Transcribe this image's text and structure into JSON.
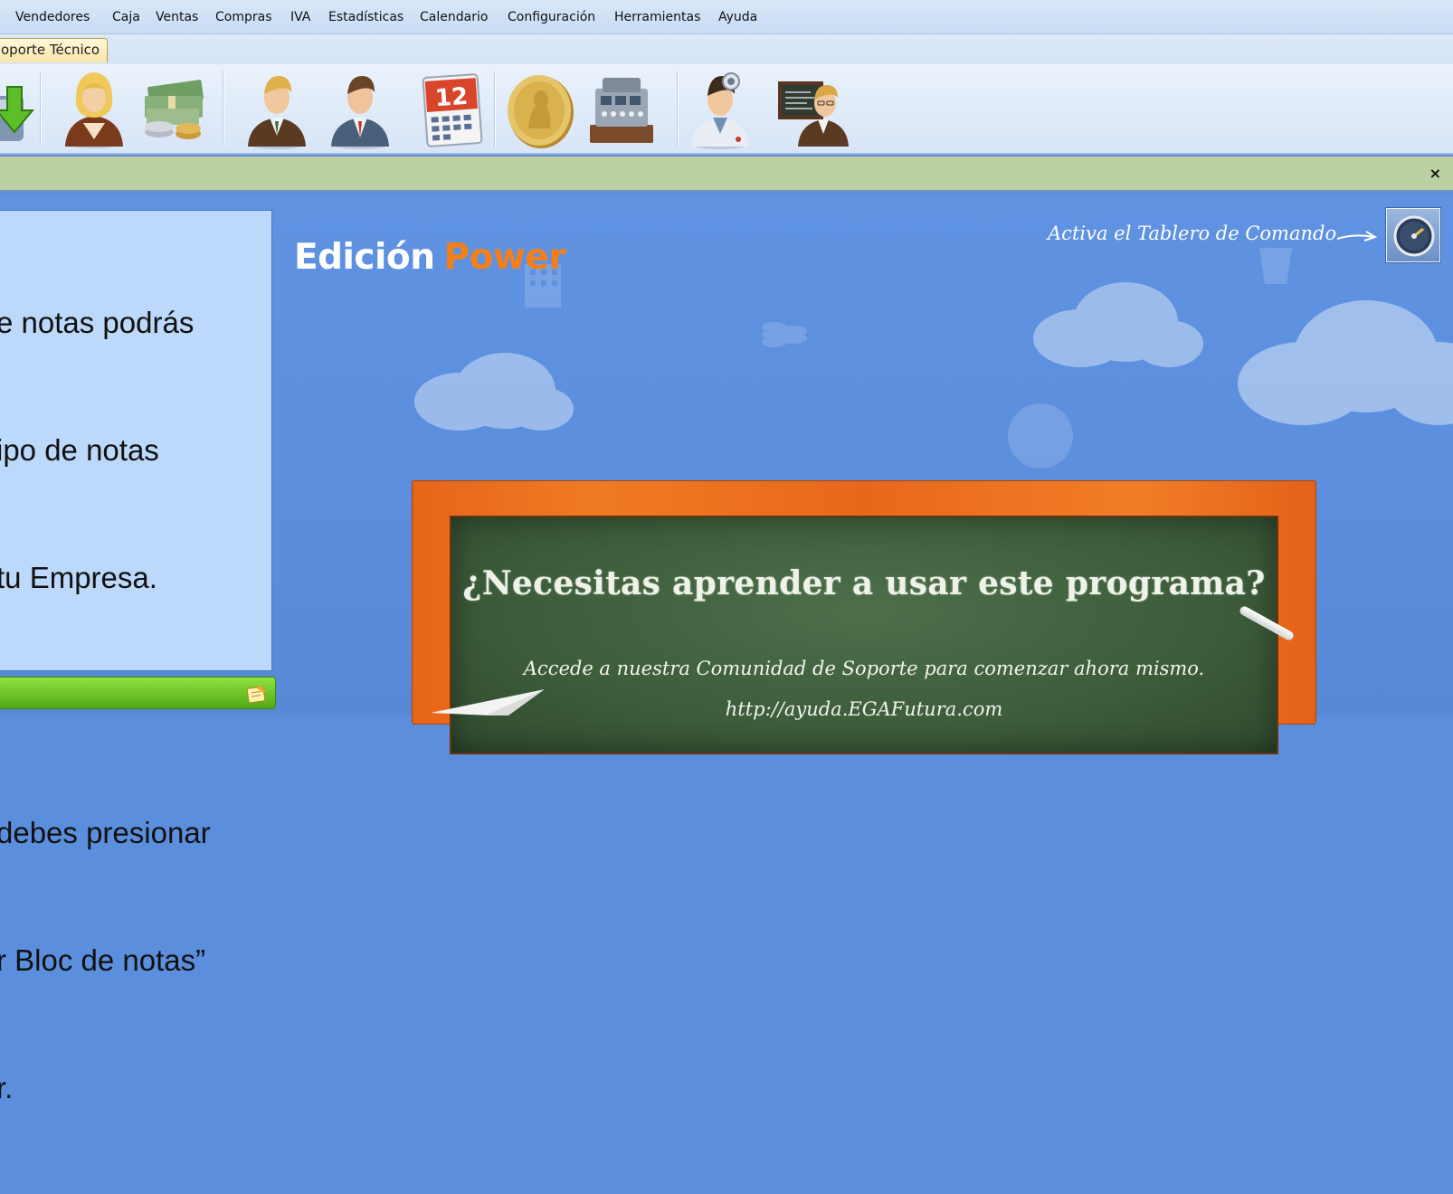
{
  "menubar": {
    "items": [
      "Vendedores",
      "Caja",
      "Ventas",
      "Compras",
      "IVA",
      "Estadísticas",
      "Calendario",
      "Configuración",
      "Herramientas",
      "Ayuda"
    ]
  },
  "tabs": {
    "active": "oporte Técnico"
  },
  "toolbar": {
    "buttons": [
      "download-icon",
      "female-user-icon",
      "money-icon",
      "businessman-icon",
      "seller-icon",
      "calendar-icon",
      "coin-icon",
      "cash-register-icon",
      "doctor-icon",
      "teacher-icon"
    ],
    "calendar_day": "12"
  },
  "notification": {
    "close_label": "×"
  },
  "side_panel": {
    "lines": [
      "e notas podrás",
      "ipo de notas",
      "tu Empresa.",
      "",
      "debes presionar",
      "r Bloc de notas”",
      "r."
    ]
  },
  "brand": {
    "part1": "Edición",
    "part2": "Power"
  },
  "dashboard": {
    "label": "Activa el Tablero de Comando"
  },
  "board": {
    "title": "¿Necesitas aprender a usar este programa?",
    "subtitle": "Accede a nuestra Comunidad de Soporte para comenzar ahora mismo.",
    "url": "http://ayuda.EGAFutura.com"
  },
  "colors": {
    "brand_accent": "#f57f17",
    "background": "#5b8fdd",
    "notification": "#bccfa0",
    "side_panel": "#bcd8fb"
  }
}
